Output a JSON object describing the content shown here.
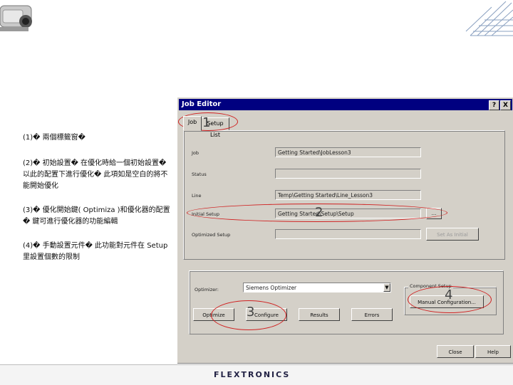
{
  "notes": [
    "(1)� 兩個標籤窗�",
    "(2)� 初始設置� 在優化時給一個初始設置� 以此的配置下進行優化� 此項如是空白的將不能開始優化",
    "(3)� 優化開始鍵( Optimiza )和優化器的配置� 鍵可進行優化器的功能編輯",
    "(4)� 手動設置元件� 此功能對元件在 Setup里設置個數的限制"
  ],
  "dialog": {
    "title": "Job Editor",
    "help_btn": "?",
    "close_btn": "X",
    "tabs": [
      "Job",
      "Setup List"
    ],
    "fields": [
      {
        "label": "Job",
        "value": "Getting Started\\JobLesson3"
      },
      {
        "label": "Status",
        "value": ""
      },
      {
        "label": "Line",
        "value": "Temp\\Getting Started\\Line_Lesson3"
      },
      {
        "label": "Initial Setup",
        "value": "Getting Started\\Setup\\Setup"
      },
      {
        "label": "Optimized Setup",
        "value": ""
      }
    ],
    "browse_btn": "...",
    "set_as_initial_btn": "Set As Initial",
    "optimizer_label": "Optimizer:",
    "optimizer_value": "Siemens Optimizer",
    "component_setup_title": "Component Setup",
    "manual_config_btn": "Manual Configuration...",
    "buttons": {
      "optimize": "Optimize",
      "configure": "Configure",
      "results": "Results",
      "errors": "Errors",
      "close": "Close",
      "help": "Help"
    }
  },
  "annotations": [
    "1",
    "2",
    "3",
    "4"
  ],
  "footer": {
    "brand": "FLEXTRONICS"
  }
}
